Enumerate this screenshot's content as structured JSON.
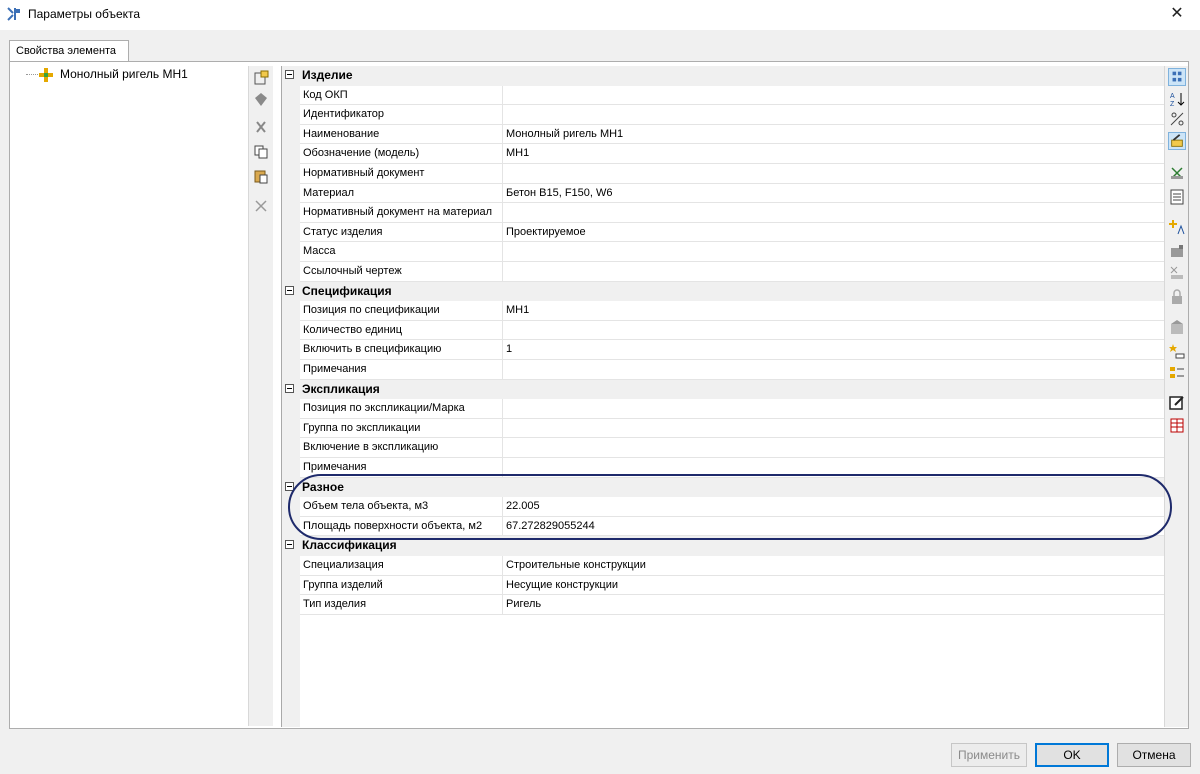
{
  "window": {
    "title": "Параметры объекта"
  },
  "tab": {
    "label": "Свойства элемента"
  },
  "tree": {
    "root_label": "Монолный ригель МН1"
  },
  "categories": [
    {
      "label": "Изделие",
      "rows": [
        {
          "name": "Код ОКП",
          "value": ""
        },
        {
          "name": "Идентификатор",
          "value": ""
        },
        {
          "name": "Наименование",
          "value": "Монолный ригель МН1"
        },
        {
          "name": "Обозначение (модель)",
          "value": "МН1"
        },
        {
          "name": "Нормативный документ",
          "value": ""
        },
        {
          "name": "Материал",
          "value": "Бетон В15, F150, W6"
        },
        {
          "name": "Нормативный документ на материал",
          "value": ""
        },
        {
          "name": "Статус изделия",
          "value": "Проектируемое"
        },
        {
          "name": "Масса",
          "value": ""
        },
        {
          "name": "Ссылочный чертеж",
          "value": ""
        }
      ]
    },
    {
      "label": "Спецификация",
      "rows": [
        {
          "name": "Позиция по спецификации",
          "value": "МН1"
        },
        {
          "name": "Количество единиц",
          "value": ""
        },
        {
          "name": "Включить в спецификацию",
          "value": "1"
        },
        {
          "name": "Примечания",
          "value": ""
        }
      ]
    },
    {
      "label": "Экспликация",
      "rows": [
        {
          "name": "Позиция по экспликации/Марка",
          "value": ""
        },
        {
          "name": "Группа по экспликации",
          "value": ""
        },
        {
          "name": "Включение в экспликацию",
          "value": ""
        },
        {
          "name": "Примечания",
          "value": ""
        }
      ]
    },
    {
      "label": "Разное",
      "rows": [
        {
          "name": "Объем тела объекта, м3",
          "value": "22.005"
        },
        {
          "name": "Площадь поверхности объекта, м2",
          "value": "67.272829055244"
        }
      ]
    },
    {
      "label": "Классификация",
      "rows": [
        {
          "name": "Специализация",
          "value": "Строительные конструкции"
        },
        {
          "name": "Группа изделий",
          "value": "Несущие конструкции"
        },
        {
          "name": "Тип изделия",
          "value": "Ригель"
        }
      ]
    }
  ],
  "left_toolbar_icons": [
    "new-element-icon",
    "tag-icon",
    "cut-icon",
    "copy-icon",
    "paste-icon",
    "delete-icon"
  ],
  "right_toolbar_icons": [
    "categorized-view-icon",
    "sort-az-icon",
    "filter-icon",
    "edit-props-icon",
    "tools-icon",
    "list-icon",
    "add-parameter-icon",
    "template-icon",
    "remove-parameter-icon",
    "lock-icon",
    "building-icon",
    "new-property-icon",
    "property-list-icon",
    "edit-note-icon",
    "table-delete-icon"
  ],
  "buttons": {
    "apply": "Применить",
    "ok": "OK",
    "cancel": "Отмена"
  },
  "colors": {
    "accent": "#0078d7",
    "highlight_outline": "#1e2a6b",
    "category_bg": "#f0f0f0"
  }
}
